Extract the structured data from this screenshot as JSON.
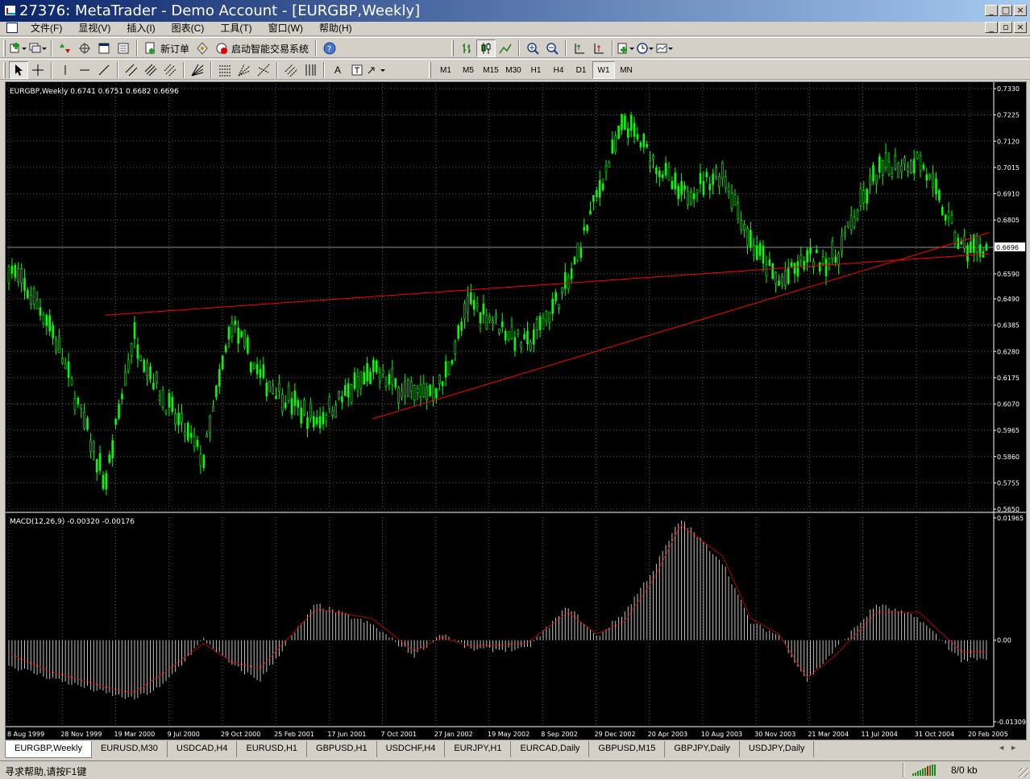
{
  "window": {
    "title": "27376: MetaTrader - Demo Account - [EURGBP,Weekly]",
    "buttons": [
      "_",
      "□",
      "×"
    ]
  },
  "menu": {
    "items": [
      "文件(F)",
      "显视(V)",
      "插入(I)",
      "图表(C)",
      "工具(T)",
      "窗口(W)",
      "帮助(H)"
    ],
    "mdi_buttons": [
      "_",
      "▫",
      "×"
    ]
  },
  "toolbar1": {
    "new_order_label": "新订单",
    "expert_label": "启动智能交易系统"
  },
  "toolbar2": {
    "periods": [
      "M1",
      "M5",
      "M15",
      "M30",
      "H1",
      "H4",
      "D1",
      "W1",
      "MN"
    ],
    "active_period": "W1",
    "text_tool_label": "A"
  },
  "chart": {
    "info_label": "EURGBP,Weekly  0.6741 0.6751 0.6682 0.6696",
    "current_price_label": "0.6696",
    "macd_label": "MACD(12,26,9) -0.00320 -0.00176",
    "colors": {
      "background": "#000000",
      "grid": "#5a5a5a",
      "candle": "#00ff00",
      "trendline": "#ff0000",
      "macd_histogram": "#c0c0c0",
      "macd_signal": "#ff0000",
      "axis_text": "#ffffff"
    }
  },
  "chart_data": {
    "type": "line",
    "title": "EURGBP,Weekly",
    "subtitle": "0.6741 0.6751 0.6682 0.6696",
    "price_ticks": [
      "0.7330",
      "0.7225",
      "0.7120",
      "0.7015",
      "0.6910",
      "0.6805",
      "0.6590",
      "0.6490",
      "0.6385",
      "0.6280",
      "0.6175",
      "0.6070",
      "0.5965",
      "0.5860",
      "0.5755",
      "0.5650"
    ],
    "price_range": [
      0.565,
      0.733
    ],
    "current_price": 0.6696,
    "date_ticks": [
      "8 Aug 1999",
      "28 Nov 1999",
      "19 Mar 2000",
      "9 Jul 2000",
      "29 Oct 2000",
      "25 Feb 2001",
      "17 Jun 2001",
      "7 Oct 2001",
      "27 Jan 2002",
      "19 May 2002",
      "8 Sep 2002",
      "29 Dec 2002",
      "20 Apr 2003",
      "10 Aug 2003",
      "30 Nov 2003",
      "21 Mar 2004",
      "11 Jul 2004",
      "31 Oct 2004",
      "20 Feb 2005"
    ],
    "series": [
      {
        "x": [
          "1999-08",
          "1999-11",
          "2000-03",
          "2000-05",
          "2000-07",
          "2000-10",
          "2000-12",
          "2001-02",
          "2001-06",
          "2001-10",
          "2002-01",
          "2002-03",
          "2002-05",
          "2002-09",
          "2002-12",
          "2003-02",
          "2003-04",
          "2003-06",
          "2003-08",
          "2003-11",
          "2004-01",
          "2004-03",
          "2004-05",
          "2004-07",
          "2004-10",
          "2005-01",
          "2005-04"
        ],
        "values": [
          0.663,
          0.64,
          0.575,
          0.635,
          0.61,
          0.585,
          0.64,
          0.618,
          0.6,
          0.62,
          0.61,
          0.615,
          0.648,
          0.63,
          0.655,
          0.69,
          0.72,
          0.705,
          0.69,
          0.7,
          0.672,
          0.655,
          0.665,
          0.665,
          0.7,
          0.705,
          0.6696
        ]
      }
    ],
    "trendlines": [
      {
        "from": [
          "2000-03",
          0.6425
        ],
        "to": [
          "2005-06",
          0.667
        ]
      },
      {
        "from": [
          "2001-10",
          0.601
        ],
        "to": [
          "2005-06",
          0.6755
        ]
      }
    ],
    "macd": {
      "label": "MACD(12,26,9) -0.00320 -0.00176",
      "range": [
        -0.0131,
        0.0195
      ],
      "ticks": [
        "0.01965",
        "0.00",
        "-0.01309"
      ],
      "histogram": [
        -0.004,
        -0.006,
        -0.0085,
        -0.0095,
        -0.0075,
        0.0002,
        -0.004,
        -0.0065,
        0.0058,
        0.0025,
        -0.0025,
        0.0012,
        -0.0015,
        -0.0015,
        0.0055,
        0.0005,
        0.0045,
        0.0112,
        0.0195,
        0.0125,
        0.0028,
        0.0008,
        -0.0065,
        -0.0015,
        0.0058,
        0.0035,
        -0.0032
      ],
      "signal": [
        -0.002,
        -0.005,
        -0.0075,
        -0.0085,
        -0.0055,
        -0.0005,
        -0.0035,
        -0.0045,
        0.005,
        0.0035,
        -0.0018,
        0.0005,
        -0.001,
        -0.0005,
        0.0045,
        0.001,
        0.003,
        0.0095,
        0.0185,
        0.0135,
        0.0035,
        0.001,
        -0.006,
        -0.0025,
        0.0045,
        0.0045,
        -0.0018
      ]
    }
  },
  "tabs": [
    "EURGBP,Weekly",
    "EURUSD,M30",
    "USDCAD,H4",
    "EURUSD,H1",
    "GBPUSD,H1",
    "USDCHF,H4",
    "EURJPY,H1",
    "EURCAD,Daily",
    "GBPUSD,M15",
    "GBPJPY,Daily",
    "USDJPY,Daily"
  ],
  "active_tab": 0,
  "status": {
    "help_text": "寻求帮助,请按F1键",
    "traffic": "8/0 kb"
  }
}
